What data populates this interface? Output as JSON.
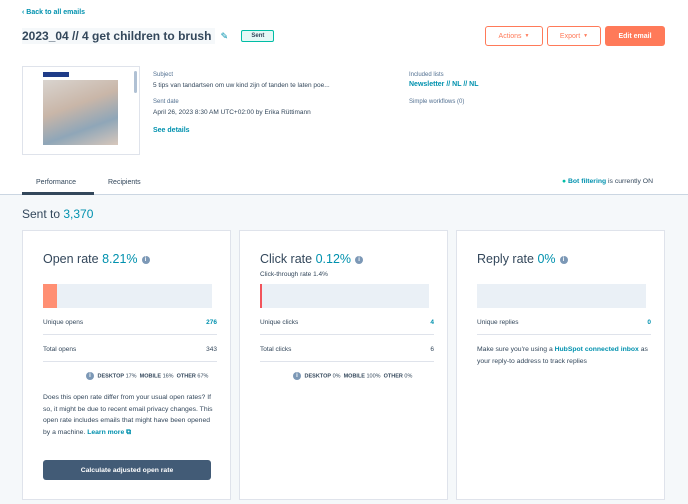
{
  "nav": {
    "back_label": "Back to all emails"
  },
  "header": {
    "title": "2023_04 // 4 get children to brush",
    "status": "Sent",
    "actions_label": "Actions",
    "export_label": "Export",
    "edit_label": "Edit email"
  },
  "details": {
    "subject_label": "Subject",
    "subject_value": "5 tips van tandartsen om uw kind zijn of tanden te laten poe...",
    "sent_date_label": "Sent date",
    "sent_date_value": "April 26, 2023 8:30 AM UTC+02:00 by Erika Rüttimann",
    "see_details": "See details",
    "included_lists_label": "Included lists",
    "included_lists_value": "Newsletter // NL // NL",
    "workflows_label": "Simple workflows (0)"
  },
  "tabs": [
    {
      "label": "Performance",
      "active": true
    },
    {
      "label": "Recipients",
      "active": false
    }
  ],
  "bot_filtering": {
    "label": "Bot filtering",
    "suffix": "is currently ON"
  },
  "summary": {
    "sent_to_label": "Sent to",
    "sent_to_value": "3,370"
  },
  "cards": {
    "open": {
      "title": "Open rate",
      "rate": "8.21%",
      "fill_fraction": 0.082,
      "unique_label": "Unique opens",
      "unique_value": "276",
      "total_label": "Total opens",
      "total_value": "343",
      "split": [
        {
          "label": "DESKTOP",
          "value": "17%"
        },
        {
          "label": "MOBILE",
          "value": "16%"
        },
        {
          "label": "OTHER",
          "value": "67%"
        }
      ],
      "desc": "Does this open rate differ from your usual open rates? If so, it might be due to recent email privacy changes. This open rate includes emails that might have been opened by a machine.",
      "learn_more": "Learn more",
      "calc_button": "Calculate adjusted open rate"
    },
    "click": {
      "title": "Click rate",
      "rate": "0.12%",
      "ctr": "Click-through rate 1.4%",
      "fill_fraction": 0.012,
      "unique_label": "Unique clicks",
      "unique_value": "4",
      "total_label": "Total clicks",
      "total_value": "6",
      "split": [
        {
          "label": "DESKTOP",
          "value": "0%"
        },
        {
          "label": "MOBILE",
          "value": "100%"
        },
        {
          "label": "OTHER",
          "value": "0%"
        }
      ]
    },
    "reply": {
      "title": "Reply rate",
      "rate": "0%",
      "fill_fraction": 0,
      "unique_label": "Unique replies",
      "unique_value": "0",
      "note_pre": "Make sure you're using a",
      "note_link": "HubSpot connected inbox",
      "note_post": "as your reply-to address to track replies"
    }
  },
  "colors": {
    "accent": "#0091ae",
    "open_fill": "#ff8f73",
    "click_fill": "#f2545b",
    "primary_button": "#ff7a59",
    "dark_button": "#425b76"
  }
}
